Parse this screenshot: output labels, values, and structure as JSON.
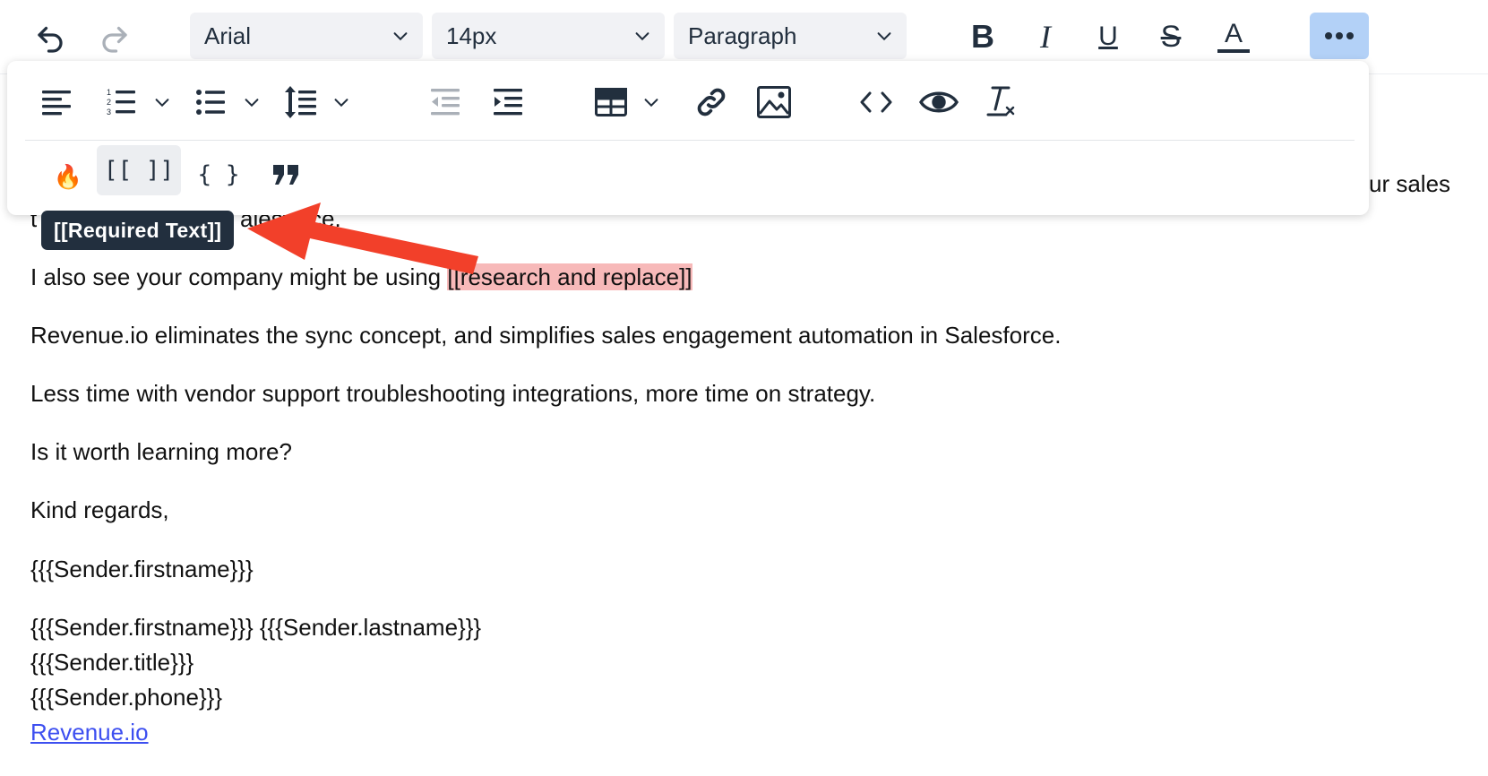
{
  "toolbar": {
    "font_family": "Arial",
    "font_size": "14px",
    "block_format": "Paragraph",
    "bold_label": "B",
    "italic_label": "I",
    "underline_label": "U",
    "strikethrough_label": "S",
    "text_color_label": "A"
  },
  "more_toolbar": {
    "emoji": "🔥",
    "required_text_label": "[[ ]]",
    "merge_field_label": "{ }",
    "active_button": "required-text-button"
  },
  "tooltip": {
    "text": "[[Required Text]]"
  },
  "body": {
    "line1_tail": "ur sales",
    "line2_fragment_a": "t",
    "line2_fragment_b": "alesforce.",
    "line3_prefix": "I also see your company might be using ",
    "line3_highlight": "[[research and replace]]",
    "line4": "Revenue.io eliminates the sync concept, and simplifies sales engagement automation in Salesforce.",
    "line5": "Less time with vendor support troubleshooting integrations, more time on strategy.",
    "line6": "Is it worth learning more?",
    "line7": "Kind regards,",
    "line8": "{{{Sender.firstname}}}",
    "sig1": "{{{Sender.firstname}}} {{{Sender.lastname}}}",
    "sig2": "{{{Sender.title}}}",
    "sig3": "{{{Sender.phone}}}",
    "sig_link": "Revenue.io"
  },
  "colors": {
    "highlight": "#f7b9b9",
    "arrow": "#f2402a",
    "tooltip_bg": "#222f3e",
    "more_active": "#b3d1f7",
    "link": "#3d4ff0"
  }
}
